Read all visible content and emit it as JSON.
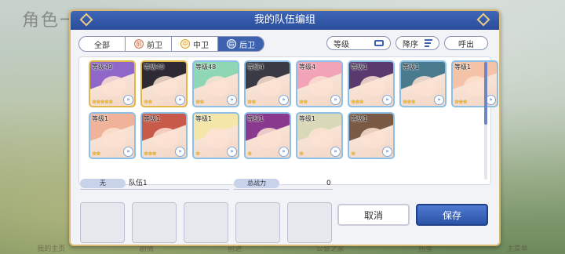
{
  "background": {
    "title": "角色一览",
    "nav": [
      "我的主页",
      "剧情",
      "前进",
      "公会之家",
      "扭蛋",
      "主菜单"
    ]
  },
  "dialog": {
    "title": "我的队伍编组",
    "tabs": [
      {
        "label": "全部",
        "icon": "",
        "active": false
      },
      {
        "label": "前卫",
        "icon": "前",
        "active": false
      },
      {
        "label": "中卫",
        "icon": "中",
        "active": false
      },
      {
        "label": "后卫",
        "icon": "后",
        "active": true
      }
    ],
    "sort_field": "等级",
    "sort_order": "降序",
    "recall": "呼出",
    "characters": [
      {
        "level": "等级49",
        "stars": 5,
        "hair": "#8e67c8",
        "gold": true
      },
      {
        "level": "等级49",
        "stars": 2,
        "hair": "#2d2a33",
        "gold": true
      },
      {
        "level": "等级48",
        "stars": 2,
        "hair": "#8fd6b4",
        "gold": false
      },
      {
        "level": "等级4",
        "stars": 2,
        "hair": "#3a3a44",
        "gold": false
      },
      {
        "level": "等级4",
        "stars": 2,
        "hair": "#f2a3b8",
        "gold": false
      },
      {
        "level": "等级1",
        "stars": 3,
        "hair": "#5a3a6e",
        "gold": false
      },
      {
        "level": "等级1",
        "stars": 3,
        "hair": "#4a7a8e",
        "gold": false
      },
      {
        "level": "等级1",
        "stars": 3,
        "hair": "#f4c2a6",
        "gold": false
      },
      {
        "level": "等级1",
        "stars": 2,
        "hair": "#f0b39a",
        "gold": false
      },
      {
        "level": "等级1",
        "stars": 3,
        "hair": "#c85a4a",
        "gold": false
      },
      {
        "level": "等级1",
        "stars": 1,
        "hair": "#f3e6a8",
        "gold": false
      },
      {
        "level": "等级1",
        "stars": 1,
        "hair": "#8a3a8e",
        "gold": false
      },
      {
        "level": "等级1",
        "stars": 1,
        "hair": "#d9d8b8",
        "gold": false
      },
      {
        "level": "等级1",
        "stars": 1,
        "hair": "#7a5a44",
        "gold": false
      }
    ],
    "team_label": "无",
    "team_name": "队伍1",
    "power_label": "总战力",
    "power_value": "0",
    "cancel": "取消",
    "save": "保存",
    "colors": {
      "header": "#2f56a6",
      "border": "#d9b870",
      "accent": "#3c62b0"
    }
  }
}
